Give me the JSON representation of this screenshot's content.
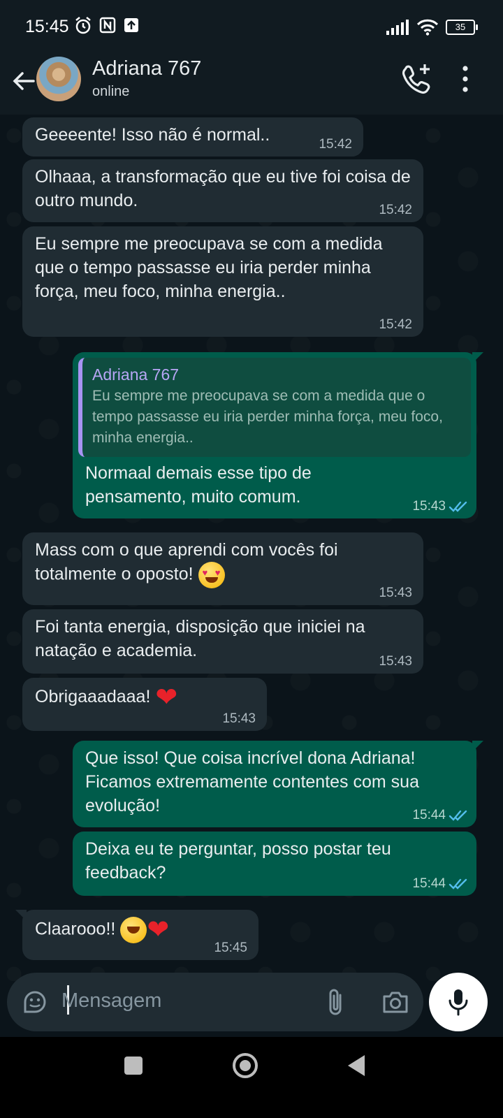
{
  "status_bar": {
    "time": "15:45",
    "battery": "35"
  },
  "header": {
    "contact_name": "Adriana 767",
    "contact_status": "online"
  },
  "messages": [
    {
      "dir": "in",
      "text": "Geeeente! Isso não é normal..",
      "time": "15:42"
    },
    {
      "dir": "in",
      "text": "Olhaaa, a transformação que eu tive foi coisa de outro mundo.",
      "time": "15:42"
    },
    {
      "dir": "in",
      "text": "Eu sempre me preocupava se com a medida que o tempo passasse eu iria perder minha força, meu foco, minha energia..",
      "time": "15:42"
    },
    {
      "dir": "out",
      "quote_name": "Adriana 767",
      "quote_text": "Eu sempre me preocupava se com a medida que o tempo passasse eu iria perder minha força, meu foco, minha energia..",
      "text": "Normaal demais esse tipo de pensamento, muito comum.",
      "time": "15:43"
    },
    {
      "dir": "in",
      "text": "Mass com o que aprendi com vocês foi totalmente o oposto!",
      "emoji": "heart-eyes-emoji",
      "time": "15:43"
    },
    {
      "dir": "in",
      "text": "Foi tanta energia, disposição que iniciei na natação e academia.",
      "time": "15:43"
    },
    {
      "dir": "in",
      "text": "Obrigaaadaaa!",
      "emoji": "red-heart-emoji",
      "time": "15:43"
    },
    {
      "dir": "out",
      "text": "Que isso! Que coisa incrível dona Adriana! Ficamos extremamente contentes com sua evolução!",
      "time": "15:44"
    },
    {
      "dir": "out",
      "text": "Deixa eu te perguntar, posso postar teu feedback?",
      "time": "15:44"
    },
    {
      "dir": "in",
      "text": "Claarooo!!",
      "emoji": "hugging-face-and-red-heart-emoji",
      "time": "15:45"
    }
  ],
  "composer": {
    "placeholder": "Mensagem"
  },
  "icons": {
    "back": "arrow-back-icon",
    "call": "add-call-icon",
    "menu": "more-vert-icon",
    "sticker": "sticker-icon",
    "attach": "paperclip-icon",
    "camera": "camera-icon",
    "mic": "microphone-icon",
    "read": "double-check-icon"
  },
  "colors": {
    "incoming_bubble": "#202c33",
    "outgoing_bubble": "#005c4b",
    "read_ticks": "#53bdeb",
    "quote_bar": "#a793f2",
    "background": "#0b141a"
  }
}
